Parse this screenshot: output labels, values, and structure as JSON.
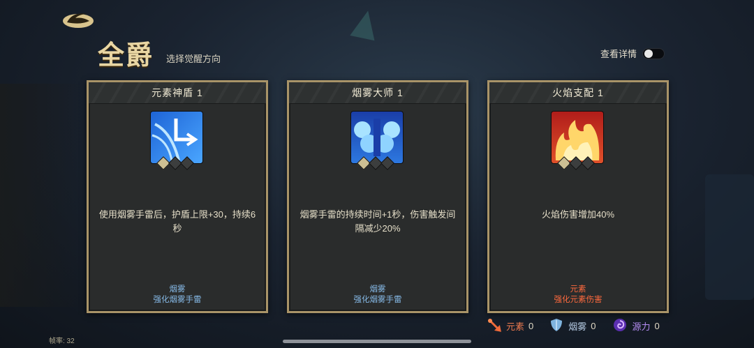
{
  "header": {
    "title": "全爵",
    "subtitle": "选择觉醒方向",
    "detail_label": "查看详情",
    "detail_toggle_on": false
  },
  "cards": [
    {
      "name": "元素神盾 1",
      "icon": "shield-break-icon",
      "icon_colors": [
        "#1e64d6",
        "#7fc6ff"
      ],
      "level_filled": 1,
      "level_total": 3,
      "description": "使用烟雾手雷后，护盾上限+30，持续6秒",
      "tag": "烟雾",
      "tag_detail": "强化烟雾手雷",
      "tag_color": "#86b9e6"
    },
    {
      "name": "烟雾大师 1",
      "icon": "smoke-cloud-icon",
      "icon_colors": [
        "#1a4fbf",
        "#9fdcff"
      ],
      "level_filled": 1,
      "level_total": 3,
      "description": "烟雾手雷的持续时间+1秒，伤害触发间隔减少20%",
      "tag": "烟雾",
      "tag_detail": "强化烟雾手雷",
      "tag_color": "#86b9e6"
    },
    {
      "name": "火焰支配 1",
      "icon": "flame-icon",
      "icon_colors": [
        "#c8241f",
        "#ffd970"
      ],
      "level_filled": 1,
      "level_total": 3,
      "description": "火焰伤害增加40%",
      "tag": "元素",
      "tag_detail": "强化元素伤害",
      "tag_color": "#ff6a3e"
    }
  ],
  "resources": [
    {
      "label": "元素",
      "value": "0",
      "icon": "flame-sword-icon",
      "color": "#ef7a4f"
    },
    {
      "label": "烟雾",
      "value": "0",
      "icon": "shield-icon",
      "color": "#b7cde6"
    },
    {
      "label": "源力",
      "value": "0",
      "icon": "swirl-icon",
      "color": "#b58df3"
    }
  ],
  "fps_text": "帧率: 32"
}
